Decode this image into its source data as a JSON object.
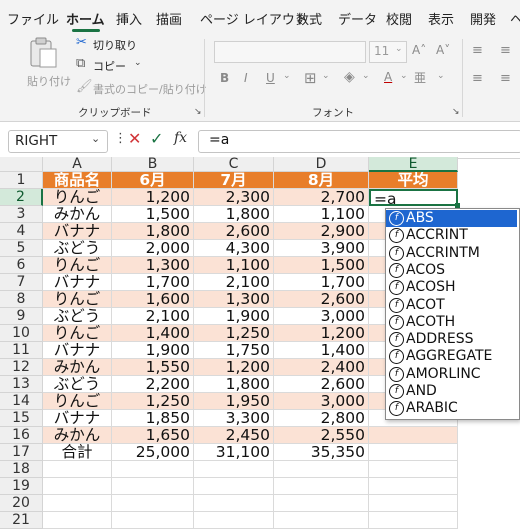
{
  "tabs": [
    "ファイル",
    "ホーム",
    "挿入",
    "描画",
    "ページ レイアウト",
    "数式",
    "データ",
    "校閲",
    "表示",
    "開発",
    "ヘ"
  ],
  "active_tab": "ホーム",
  "ribbon": {
    "paste": "貼り付け",
    "cut": "切り取り",
    "copy": "コピー",
    "format_painter": "書式のコピー/貼り付け",
    "clipboard_group": "クリップボード",
    "font_group": "フォント",
    "font_size": "11",
    "bold": "B",
    "italic": "I",
    "underline": "U"
  },
  "formula_bar": {
    "name_box": "RIGHT",
    "fx": "fx",
    "formula": "=a"
  },
  "columns": [
    "A",
    "B",
    "C",
    "D",
    "E"
  ],
  "rows": [
    "1",
    "2",
    "3",
    "4",
    "5",
    "6",
    "7",
    "8",
    "9",
    "10",
    "11",
    "12",
    "13",
    "14",
    "15",
    "16",
    "17",
    "18",
    "19",
    "20",
    "21"
  ],
  "table": {
    "header": [
      "商品名",
      "6月",
      "7月",
      "8月",
      "平均"
    ],
    "data": [
      [
        "りんご",
        "1,200",
        "2,300",
        "2,700"
      ],
      [
        "みかん",
        "1,500",
        "1,800",
        "1,100"
      ],
      [
        "バナナ",
        "1,800",
        "2,600",
        "2,900"
      ],
      [
        "ぶどう",
        "2,000",
        "4,300",
        "3,900"
      ],
      [
        "りんご",
        "1,300",
        "1,100",
        "1,500"
      ],
      [
        "バナナ",
        "1,700",
        "2,100",
        "1,700"
      ],
      [
        "りんご",
        "1,600",
        "1,300",
        "2,600"
      ],
      [
        "ぶどう",
        "2,100",
        "1,900",
        "3,000"
      ],
      [
        "りんご",
        "1,400",
        "1,250",
        "1,200"
      ],
      [
        "バナナ",
        "1,900",
        "1,750",
        "1,400"
      ],
      [
        "みかん",
        "1,550",
        "1,200",
        "2,400"
      ],
      [
        "ぶどう",
        "2,200",
        "1,800",
        "2,600"
      ],
      [
        "りんご",
        "1,250",
        "1,950",
        "3,000"
      ],
      [
        "バナナ",
        "1,850",
        "3,300",
        "2,800"
      ],
      [
        "みかん",
        "1,650",
        "2,450",
        "2,550"
      ]
    ],
    "total": [
      "合計",
      "25,000",
      "31,100",
      "35,350"
    ],
    "active_cell_text": "=a"
  },
  "autocomplete": [
    "ABS",
    "ACCRINT",
    "ACCRINTM",
    "ACOS",
    "ACOSH",
    "ACOT",
    "ACOTH",
    "ADDRESS",
    "AGGREGATE",
    "AMORLINC",
    "AND",
    "ARABIC"
  ],
  "autocomplete_selected": "ABS",
  "colors": {
    "header_fill": "#e87e2a",
    "band_fill": "#fbe2d5",
    "accent": "#1a7343",
    "selection": "#1e66d0"
  }
}
